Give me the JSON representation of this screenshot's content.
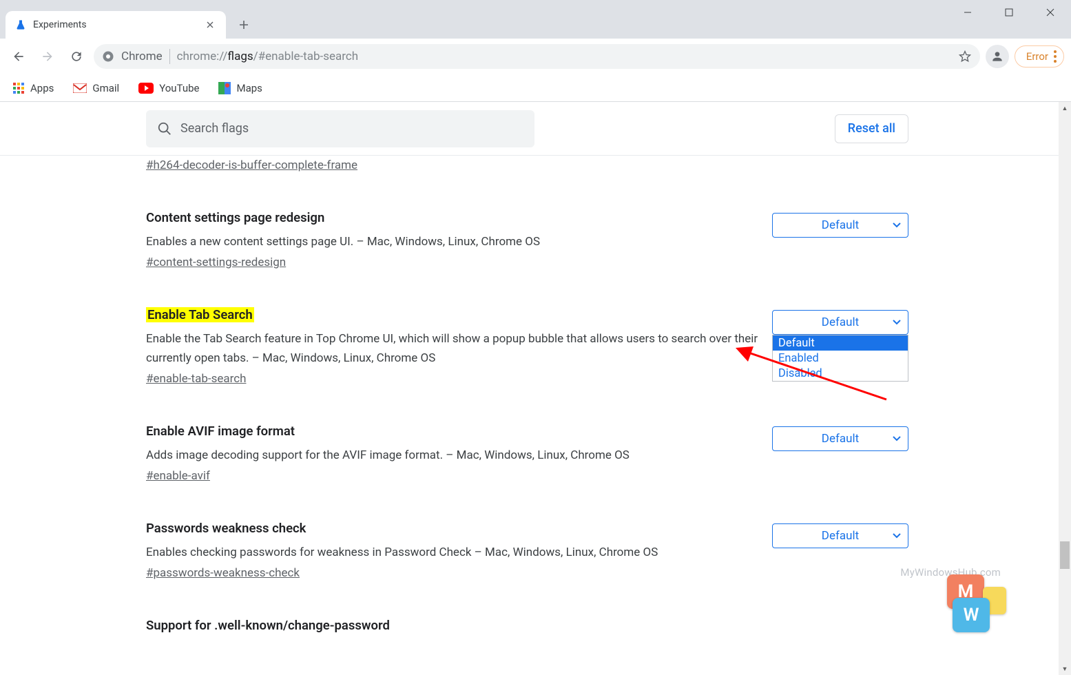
{
  "window": {
    "tab_title": "Experiments"
  },
  "toolbar": {
    "url_label": "Chrome",
    "url_prefix": "chrome://",
    "url_bold": "flags",
    "url_rest": "/#enable-tab-search",
    "error_label": "Error"
  },
  "bookmarks": {
    "apps": "Apps",
    "gmail": "Gmail",
    "youtube": "YouTube",
    "maps": "Maps"
  },
  "flags_page": {
    "search_placeholder": "Search flags",
    "reset_all": "Reset all",
    "previous_anchor": "#h264-decoder-is-buffer-complete-frame",
    "select_default": "Default",
    "dropdown_options": {
      "o0": "Default",
      "o1": "Enabled",
      "o2": "Disabled"
    },
    "flags": {
      "f0": {
        "title": "Content settings page redesign",
        "desc": "Enables a new content settings page UI. – Mac, Windows, Linux, Chrome OS",
        "anchor": "#content-settings-redesign",
        "value": "Default"
      },
      "f1": {
        "title": "Enable Tab Search",
        "desc": "Enable the Tab Search feature in Top Chrome UI, which will show a popup bubble that allows users to search over their currently open tabs. – Mac, Windows, Linux, Chrome OS",
        "anchor": "#enable-tab-search",
        "value": "Default"
      },
      "f2": {
        "title": "Enable AVIF image format",
        "desc": "Adds image decoding support for the AVIF image format. – Mac, Windows, Linux, Chrome OS",
        "anchor": "#enable-avif",
        "value": "Default"
      },
      "f3": {
        "title": "Passwords weakness check",
        "desc": "Enables checking passwords for weakness in Password Check – Mac, Windows, Linux, Chrome OS",
        "anchor": "#passwords-weakness-check",
        "value": "Default"
      },
      "f4": {
        "title": "Support for .well-known/change-password"
      }
    }
  },
  "watermark": "MyWindowsHub.com",
  "logo": {
    "m": "M",
    "w": "W"
  }
}
